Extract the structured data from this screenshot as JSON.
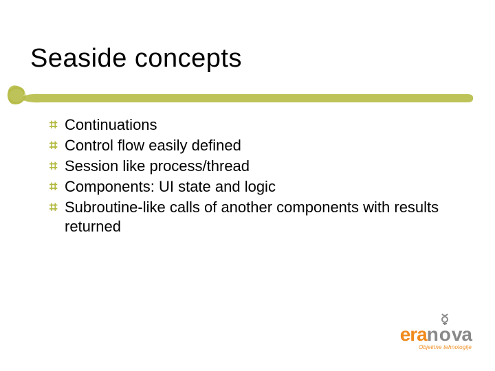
{
  "title": "Seaside concepts",
  "bullets": [
    "Continuations",
    "Control flow easily defined",
    "Session like process/thread",
    "Components: UI state and logic",
    "Subroutine-like calls of another components with results returned"
  ],
  "logo": {
    "part1": "era",
    "part2": "n",
    "part3": "va",
    "tagline": "Objektne tehnologije"
  },
  "colors": {
    "accent": "#b2b83c",
    "brand_orange": "#f08a1d",
    "brand_gray": "#898989"
  }
}
